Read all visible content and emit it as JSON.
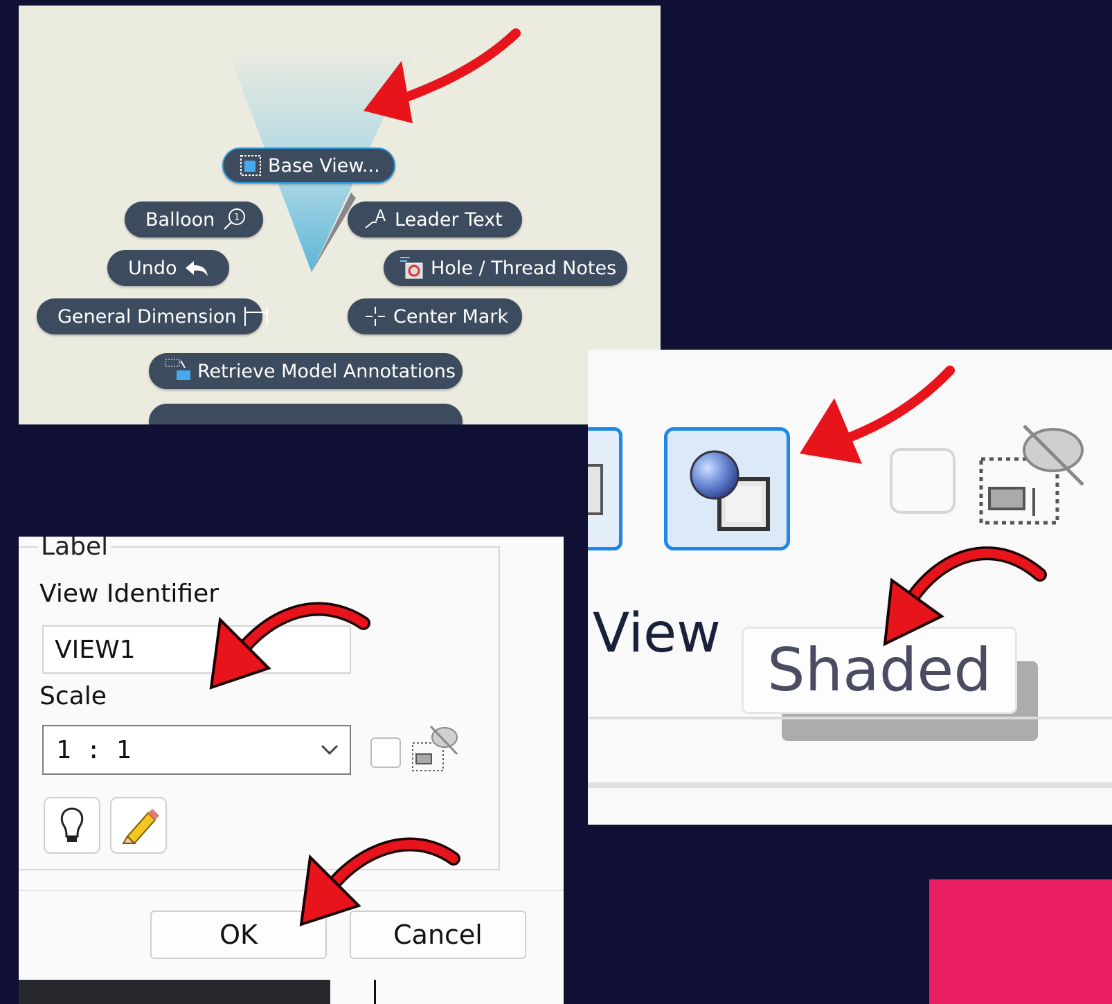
{
  "marking_menu": {
    "items": {
      "base_view": "Base View...",
      "balloon": "Balloon",
      "leader_text": "Leader Text",
      "undo": "Undo",
      "hole_thread_notes": "Hole / Thread Notes",
      "general_dimension": "General Dimension",
      "center_mark": "Center Mark",
      "retrieve_model_annotations": "Retrieve Model Annotations"
    }
  },
  "toolbar": {
    "partial_label": "r View",
    "tooltip": "Shaded",
    "shaded_button_state": "selected"
  },
  "dialog": {
    "group_label": "Label",
    "view_identifier_label": "View Identifier",
    "view_identifier_value": "VIEW1",
    "scale_label": "Scale",
    "scale_value": "1 : 1",
    "ok_label": "OK",
    "cancel_label": "Cancel"
  },
  "colors": {
    "background": "#0f1033",
    "menu_pill": "#3c4b5e",
    "menu_bg": "#ecebdf",
    "selection_blue": "#1e88e5",
    "arrow_red": "#e8141c",
    "accent_pink": "#e91e63"
  }
}
